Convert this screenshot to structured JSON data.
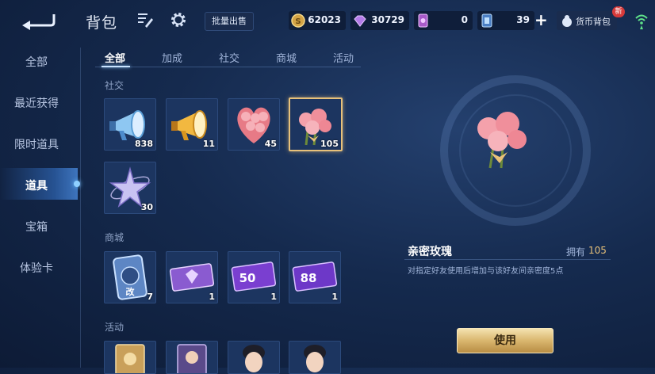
{
  "header": {
    "title": "背包",
    "bulk_sell": "批量出售",
    "currencies": [
      {
        "icon": "gold-coin-icon",
        "value": "62023"
      },
      {
        "icon": "diamond-icon",
        "value": "30729"
      },
      {
        "icon": "voucher-card-icon",
        "value": "0"
      },
      {
        "icon": "coupon-icon",
        "value": "39"
      }
    ],
    "wallet_label": "货币背包",
    "new_badge": "新"
  },
  "sidebar": {
    "items": [
      {
        "label": "全部"
      },
      {
        "label": "最近获得"
      },
      {
        "label": "限时道具"
      },
      {
        "label": "道具"
      },
      {
        "label": "宝箱"
      },
      {
        "label": "体验卡"
      }
    ],
    "active_index": 3
  },
  "tabs": [
    {
      "label": "全部"
    },
    {
      "label": "加成"
    },
    {
      "label": "社交"
    },
    {
      "label": "商城"
    },
    {
      "label": "活动"
    }
  ],
  "sections": [
    {
      "title": "社交",
      "items": [
        {
          "icon": "blue-megaphone-icon",
          "count": "838"
        },
        {
          "icon": "gold-megaphone-icon",
          "count": "11"
        },
        {
          "icon": "rose-bouquet-large-icon",
          "count": "45"
        },
        {
          "icon": "rose-bouquet-icon",
          "count": "105"
        },
        {
          "icon": "star-charm-icon",
          "count": "30"
        }
      ]
    },
    {
      "title": "商城",
      "items": [
        {
          "icon": "rename-card-icon",
          "count": "7",
          "label": "改"
        },
        {
          "icon": "purple-ticket-icon",
          "count": "1"
        },
        {
          "icon": "coupon-50-icon",
          "count": "1",
          "label": "50"
        },
        {
          "icon": "coupon-88-icon",
          "count": "1",
          "label": "88"
        }
      ]
    },
    {
      "title": "活动"
    }
  ],
  "detail": {
    "name": "亲密玫瑰",
    "owned_label": "拥有",
    "owned_value": "105",
    "description": "对指定好友使用后增加与该好友间亲密度5点",
    "use_button": "使用"
  }
}
